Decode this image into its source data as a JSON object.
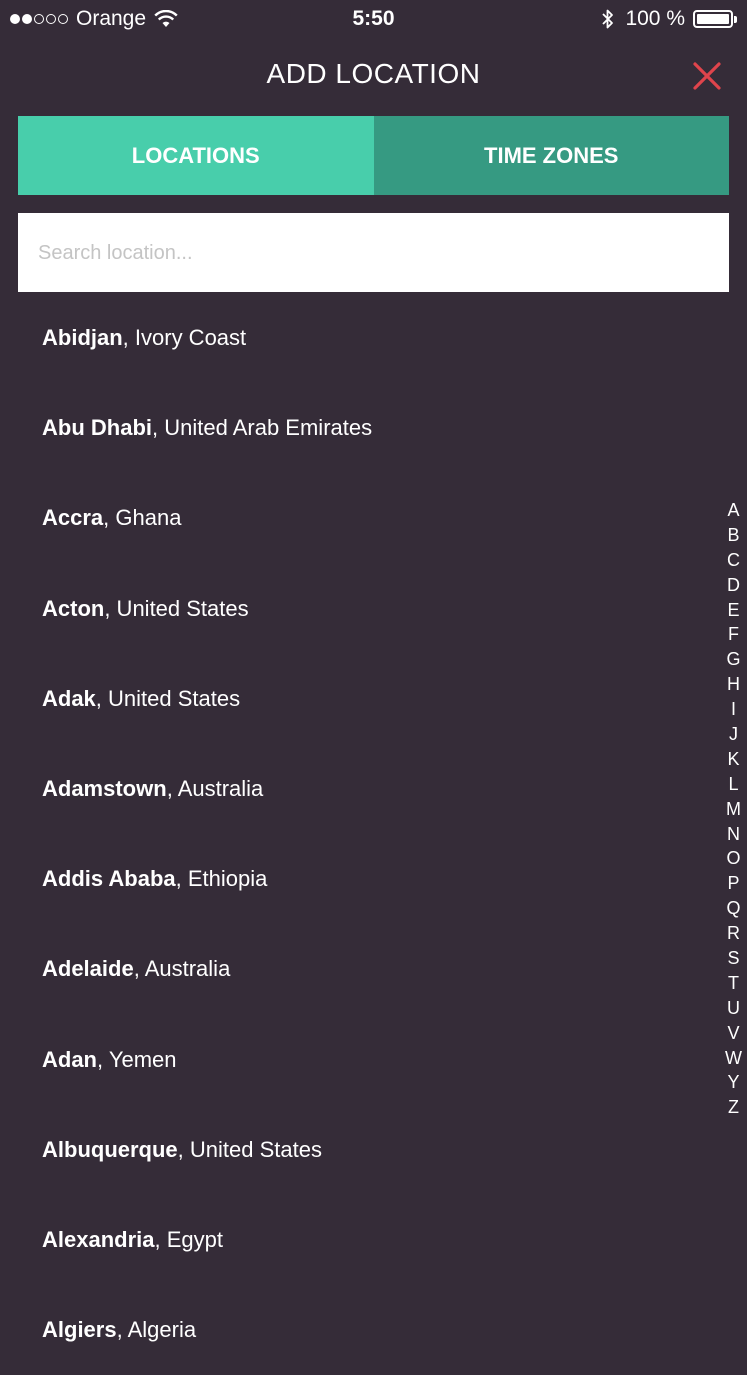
{
  "status_bar": {
    "carrier": "Orange",
    "time": "5:50",
    "battery": "100 %"
  },
  "header": {
    "title": "ADD LOCATION"
  },
  "tabs": [
    {
      "label": "LOCATIONS"
    },
    {
      "label": "TIME ZONES"
    }
  ],
  "search": {
    "placeholder": "Search location..."
  },
  "locations": [
    {
      "city": "Abidjan",
      "country": ", Ivory Coast"
    },
    {
      "city": "Abu Dhabi",
      "country": ", United Arab Emirates"
    },
    {
      "city": "Accra",
      "country": ", Ghana"
    },
    {
      "city": "Acton",
      "country": ", United States"
    },
    {
      "city": "Adak",
      "country": ", United States"
    },
    {
      "city": "Adamstown",
      "country": ", Australia"
    },
    {
      "city": "Addis Ababa",
      "country": ", Ethiopia"
    },
    {
      "city": "Adelaide",
      "country": ", Australia"
    },
    {
      "city": "Adan",
      "country": ", Yemen"
    },
    {
      "city": "Albuquerque",
      "country": ", United States"
    },
    {
      "city": "Alexandria",
      "country": ", Egypt"
    },
    {
      "city": "Algiers",
      "country": ", Algeria"
    }
  ],
  "alphabet": [
    "A",
    "B",
    "C",
    "D",
    "E",
    "F",
    "G",
    "H",
    "I",
    "J",
    "K",
    "L",
    "M",
    "N",
    "O",
    "P",
    "Q",
    "R",
    "S",
    "T",
    "U",
    "V",
    "W",
    "Y",
    "Z"
  ],
  "colors": {
    "background": "#352c38",
    "tab_active": "#48ceab",
    "tab_inactive": "#369a82",
    "close": "#e0444c"
  }
}
